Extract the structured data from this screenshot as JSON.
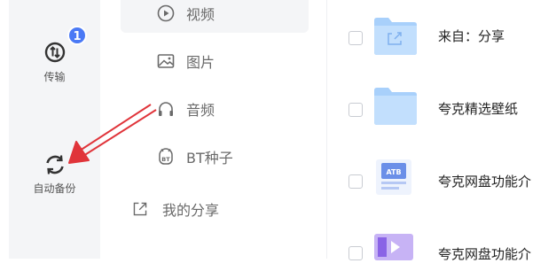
{
  "rail": {
    "items": [
      {
        "label": "传输",
        "badge": "1"
      },
      {
        "label": "自动备份"
      }
    ]
  },
  "nav": {
    "items": [
      {
        "label": "视频",
        "icon": "play-circle-icon"
      },
      {
        "label": "图片",
        "icon": "image-icon"
      },
      {
        "label": "音频",
        "icon": "headphones-icon"
      },
      {
        "label": "BT种子",
        "icon": "bt-icon"
      },
      {
        "label": "我的分享",
        "icon": "share-icon"
      }
    ]
  },
  "files": [
    {
      "name": "来自：分享",
      "type": "folder"
    },
    {
      "name": "夸克精选壁纸",
      "type": "folder"
    },
    {
      "name": "夸克网盘功能介",
      "type": "image"
    },
    {
      "name": "夸克网盘功能介",
      "type": "video"
    }
  ],
  "colors": {
    "accent": "#4a79f5",
    "folder": "#a8d0fb",
    "annotation_arrow": "#e0343a",
    "rail_bg": "#f4f5f7"
  }
}
